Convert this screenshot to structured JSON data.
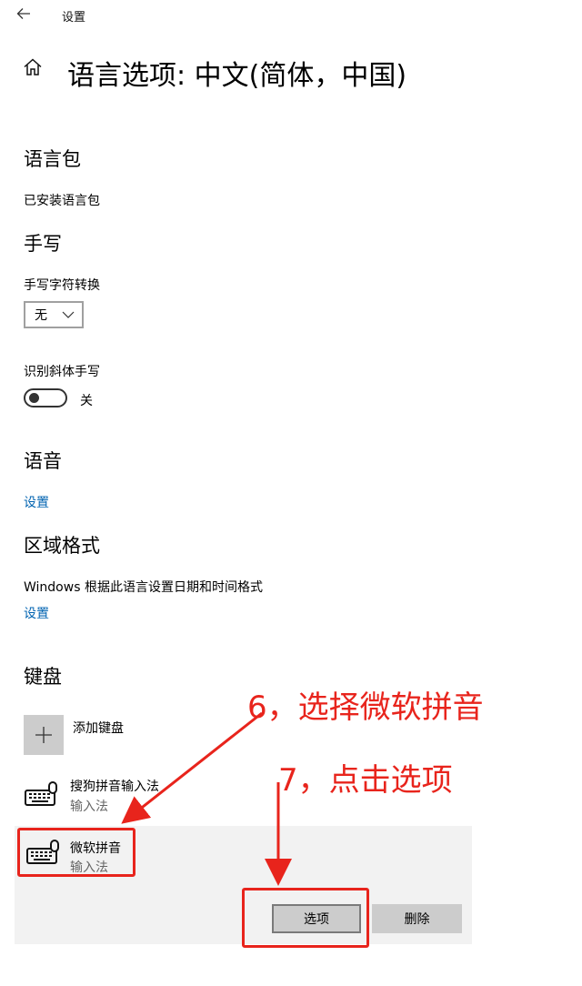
{
  "titlebar": {
    "back_icon": "arrow-left-icon",
    "title": "设置"
  },
  "page": {
    "home_icon": "home-icon",
    "title": "语言选项: 中文(简体，中国)"
  },
  "language_pack": {
    "heading": "语言包",
    "status": "已安装语言包"
  },
  "handwriting": {
    "heading": "手写",
    "conversion_label": "手写字符转换",
    "conversion_value": "无",
    "italic_label": "识别斜体手写",
    "italic_state": "关"
  },
  "speech": {
    "heading": "语音",
    "settings_link": "设置"
  },
  "region": {
    "heading": "区域格式",
    "description": "Windows 根据此语言设置日期和时间格式",
    "settings_link": "设置"
  },
  "keyboard": {
    "heading": "键盘",
    "add_label": "添加键盘",
    "items": [
      {
        "name": "搜狗拼音输入法",
        "type": "输入法"
      },
      {
        "name": "微软拼音",
        "type": "输入法"
      }
    ],
    "options_button": "选项",
    "delete_button": "删除"
  },
  "annotations": {
    "step6": "6，选择微软拼音",
    "step7": "7，点击选项",
    "color": "#e8241c"
  },
  "colors": {
    "link": "#0063b1",
    "selected_bg": "#f2f2f2",
    "button_bg": "#cccccc"
  }
}
